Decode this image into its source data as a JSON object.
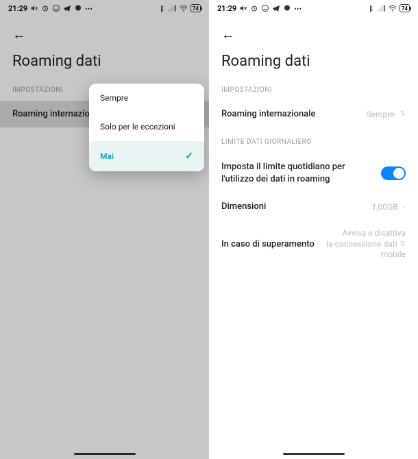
{
  "status": {
    "time": "21:29",
    "battery": "74"
  },
  "left": {
    "title": "Roaming dati",
    "section": "IMPOSTAZIONI",
    "row_label": "Roaming internazionale",
    "modal": {
      "opt1": "Sempre",
      "opt2": "Solo per le eccezioni",
      "opt3": "Mai"
    }
  },
  "right": {
    "title": "Roaming dati",
    "section1": "IMPOSTAZIONI",
    "intl_label": "Roaming internazionale",
    "intl_value": "Sempre",
    "section2": "LIMITE DATI GIORNALIERO",
    "toggle_label": "Imposta il limite quotidiano per l'utilizzo dei dati in roaming",
    "size_label": "Dimensioni",
    "size_value": "1,00GB",
    "exceed_label": "In caso di superamento",
    "exceed_value_l1": "Avvisa e disattiva",
    "exceed_value_l2": "la connessione dati",
    "exceed_value_l3": "mobile"
  }
}
